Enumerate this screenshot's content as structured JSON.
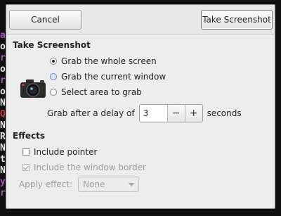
{
  "dialog": {
    "cancel_label": "Cancel",
    "take_label": "Take Screenshot"
  },
  "take_section": {
    "title": "Take Screenshot",
    "options": [
      {
        "label": "Grab the whole screen",
        "selected": true
      },
      {
        "label": "Grab the current window",
        "selected": false
      },
      {
        "label": "Select area to grab",
        "selected": false
      }
    ],
    "delay_label": "Grab after a delay of",
    "delay_value": "3",
    "delay_unit": "seconds",
    "minus_symbol": "−",
    "plus_symbol": "+",
    "icon": "camera-icon"
  },
  "effects": {
    "title": "Effects",
    "include_pointer_label": "Include pointer",
    "include_pointer_checked": false,
    "include_border_label": "Include the window border",
    "include_border_checked": true,
    "apply_effect_label": "Apply effect:",
    "apply_effect_value": "None"
  },
  "background": {
    "lines": [
      "ar",
      "oh",
      "rv",
      "oh",
      "rv",
      "or",
      "Na",
      "Qu",
      "Na",
      "Ra",
      "Na",
      "te",
      "Na",
      "y",
      "rv"
    ],
    "colors": {
      "purple": "#b14cc4",
      "red": "#d23b3b",
      "white": "#e6e6e6"
    }
  }
}
